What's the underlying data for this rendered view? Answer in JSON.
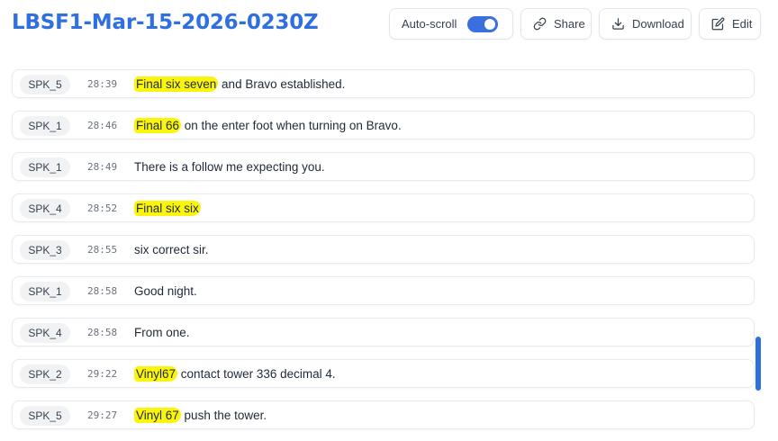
{
  "header": {
    "title": "LBSF1-Mar-15-2026-0230Z",
    "autoscroll_label": "Auto-scroll",
    "autoscroll_on": true,
    "share_label": "Share",
    "download_label": "Download",
    "edit_label": "Edit"
  },
  "colors": {
    "accent": "#2f6fe0",
    "highlight": "#fbf50c"
  },
  "icons": {
    "share": "link-icon",
    "download": "download-icon",
    "edit": "edit-icon"
  },
  "transcript": [
    {
      "speaker": "SPK_5",
      "time": "28:39",
      "highlight": "Final six seven",
      "rest": " and Bravo established."
    },
    {
      "speaker": "SPK_1",
      "time": "28:46",
      "highlight": "Final 66",
      "rest": " on the enter foot when turning on Bravo."
    },
    {
      "speaker": "SPK_1",
      "time": "28:49",
      "highlight": "",
      "rest": "There is a follow me expecting you."
    },
    {
      "speaker": "SPK_4",
      "time": "28:52",
      "highlight": "Final six six",
      "rest": ""
    },
    {
      "speaker": "SPK_3",
      "time": "28:55",
      "highlight": "",
      "rest": "six correct sir."
    },
    {
      "speaker": "SPK_1",
      "time": "28:58",
      "highlight": "",
      "rest": "Good night."
    },
    {
      "speaker": "SPK_4",
      "time": "28:58",
      "highlight": "",
      "rest": "From one."
    },
    {
      "speaker": "SPK_2",
      "time": "29:22",
      "highlight": "Vinyl67",
      "rest": " contact tower 336 decimal 4."
    },
    {
      "speaker": "SPK_5",
      "time": "29:27",
      "highlight": "Vinyl 67",
      "rest": " push the tower."
    }
  ]
}
